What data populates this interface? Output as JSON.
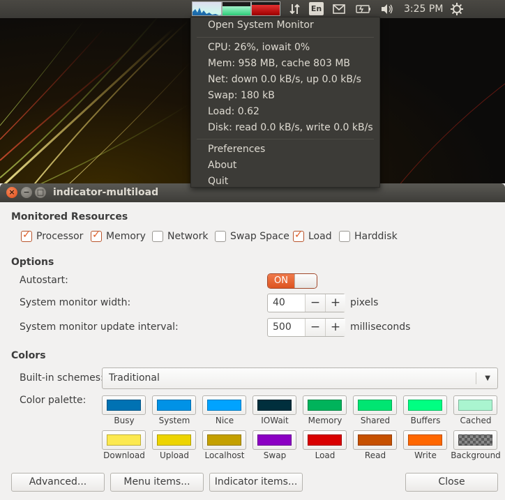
{
  "top_panel": {
    "lang_label": "En",
    "clock": "3:25 PM",
    "icons": [
      "network-arrows-icon",
      "keyboard-layout-icon",
      "mail-icon",
      "battery-icon",
      "volume-icon",
      "session-gear-icon"
    ]
  },
  "menu": {
    "open_system_monitor": "Open System Monitor",
    "stats": [
      "CPU: 26%, iowait 0%",
      "Mem: 958 MB, cache 803 MB",
      "Net: down 0.0 kB/s, up 0.0 kB/s",
      "Swap: 180 kB",
      "Load: 0.62",
      "Disk: read 0.0 kB/s, write 0.0 kB/s"
    ],
    "preferences": "Preferences",
    "about": "About",
    "quit": "Quit"
  },
  "window": {
    "title": "indicator-multiload",
    "monitored_resources": {
      "title": "Monitored Resources",
      "items": [
        {
          "label": "Processor",
          "checked": true
        },
        {
          "label": "Memory",
          "checked": true
        },
        {
          "label": "Network",
          "checked": false
        },
        {
          "label": "Swap Space",
          "checked": false
        },
        {
          "label": "Load",
          "checked": true
        },
        {
          "label": "Harddisk",
          "checked": false
        }
      ]
    },
    "options": {
      "title": "Options",
      "autostart_label": "Autostart:",
      "autostart_state": "ON",
      "width_label": "System monitor width:",
      "width_value": "40",
      "width_unit": "pixels",
      "interval_label": "System monitor update interval:",
      "interval_value": "500",
      "interval_unit": "milliseconds",
      "minus": "−",
      "plus": "+"
    },
    "colors": {
      "title": "Colors",
      "schemes_label": "Built-in schemes:",
      "scheme_value": "Traditional",
      "palette_label": "Color palette:",
      "palette_row1": [
        {
          "label": "Busy",
          "color": "#0072b3"
        },
        {
          "label": "System",
          "color": "#0092e6"
        },
        {
          "label": "Nice",
          "color": "#00a3ff"
        },
        {
          "label": "IOWait",
          "color": "#002f3d"
        },
        {
          "label": "Memory",
          "color": "#00b35b"
        },
        {
          "label": "Shared",
          "color": "#00e572"
        },
        {
          "label": "Buffers",
          "color": "#00ff82"
        },
        {
          "label": "Cached",
          "color": "#aaf5d0"
        }
      ],
      "palette_row2": [
        {
          "label": "Download",
          "color": "#fce94f"
        },
        {
          "label": "Upload",
          "color": "#edd400"
        },
        {
          "label": "Localhost",
          "color": "#c4a000"
        },
        {
          "label": "Swap",
          "color": "#8b00c3"
        },
        {
          "label": "Load",
          "color": "#d90000"
        },
        {
          "label": "Read",
          "color": "#c65000"
        },
        {
          "label": "Write",
          "color": "#ff6700"
        },
        {
          "label": "Background",
          "color": "checkered"
        }
      ]
    },
    "buttons": {
      "advanced": "Advanced...",
      "menu_items": "Menu items...",
      "indicator_items": "Indicator items...",
      "close": "Close"
    }
  }
}
